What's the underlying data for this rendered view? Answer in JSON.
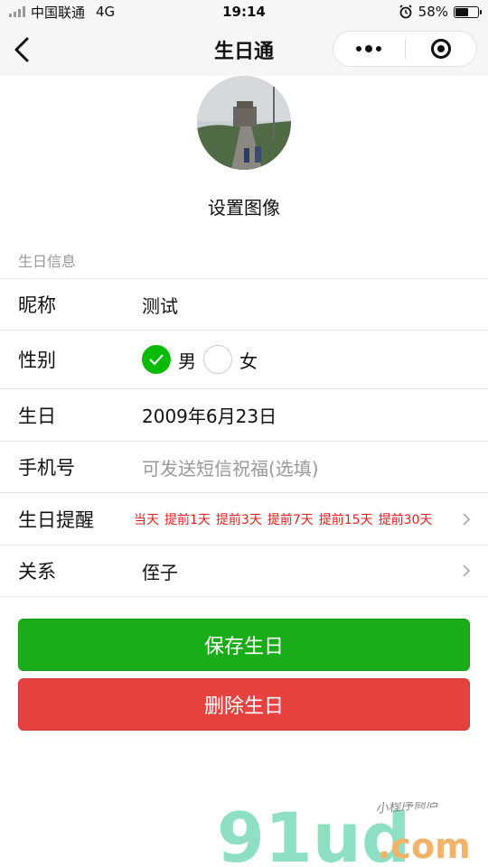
{
  "status_bar": {
    "carrier": "中国联通",
    "network": "4G",
    "time": "19:14",
    "battery_text": "58%",
    "battery_level": 0.58
  },
  "nav": {
    "title": "生日通"
  },
  "avatar": {
    "label": "设置图像"
  },
  "section": {
    "title": "生日信息"
  },
  "form": {
    "nickname": {
      "label": "昵称",
      "value": "测试"
    },
    "gender": {
      "label": "性别",
      "options": [
        "男",
        "女"
      ],
      "selected": "男"
    },
    "birthday": {
      "label": "生日",
      "value": "2009年6月23日"
    },
    "phone": {
      "label": "手机号",
      "placeholder": "可发送短信祝福(选填)"
    },
    "reminder": {
      "label": "生日提醒",
      "options": [
        "当天",
        "提前1天",
        "提前3天",
        "提前7天",
        "提前15天",
        "提前30天"
      ]
    },
    "relation": {
      "label": "关系",
      "value": "侄子"
    }
  },
  "buttons": {
    "save": "保存生日",
    "delete": "删除生日"
  },
  "watermark": {
    "brand": "91ud",
    "domain": ".com",
    "tagline": "小程序商店"
  },
  "colors": {
    "save": "#1aad19",
    "delete": "#e64340",
    "reminder": "#e02020",
    "radio_on": "#09bb07"
  }
}
